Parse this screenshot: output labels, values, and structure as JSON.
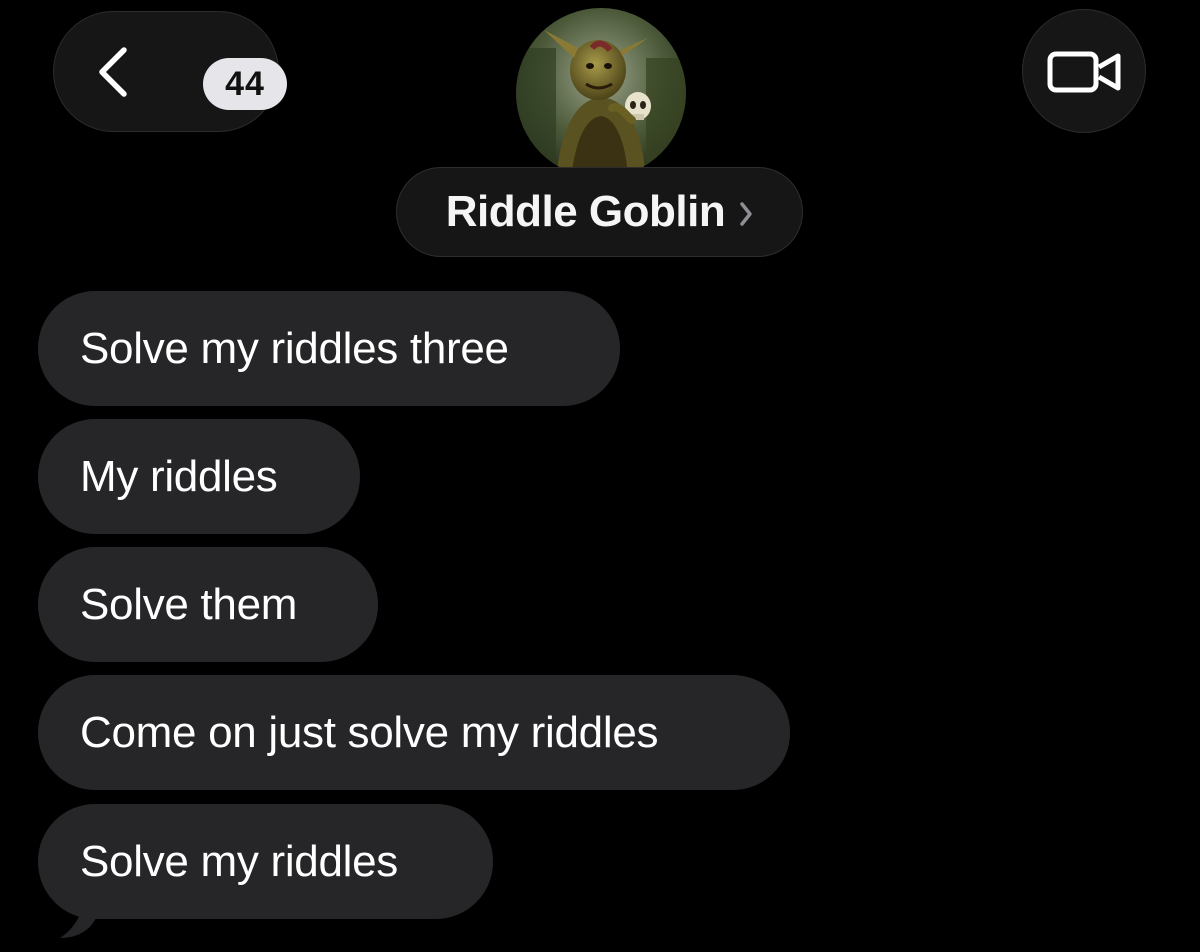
{
  "header": {
    "back_icon": "chevron-left-icon",
    "unread_count": "44",
    "video_icon": "video-camera-icon",
    "contact_name": "Riddle Goblin",
    "contact_chevron_icon": "chevron-right-icon",
    "avatar_description_icon": "goblin-avatar"
  },
  "messages": [
    {
      "text": "Solve my riddles three"
    },
    {
      "text": "My riddles"
    },
    {
      "text": "Solve them"
    },
    {
      "text": "Come on just solve my riddles"
    },
    {
      "text": "Solve my riddles"
    }
  ],
  "colors": {
    "background": "#000000",
    "bubble": "#262628",
    "header_pill": "#161616",
    "badge": "#e5e5ea"
  }
}
